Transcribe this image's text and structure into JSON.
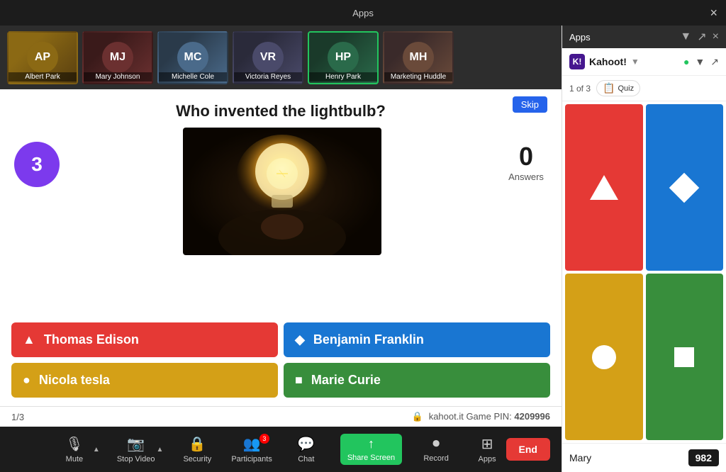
{
  "topbar": {
    "title": "Apps",
    "close_label": "×"
  },
  "video_bar": {
    "participants": [
      {
        "name": "Albert Park",
        "initials": "AP",
        "color": "#8b6914",
        "active": false
      },
      {
        "name": "Mary Johnson",
        "initials": "MJ",
        "color": "#6b3030",
        "active": false
      },
      {
        "name": "Michelle Cole",
        "initials": "MC",
        "color": "#4a6a8a",
        "active": false
      },
      {
        "name": "Victoria Reyes",
        "initials": "VR",
        "color": "#4a4a6a",
        "active": false
      },
      {
        "name": "Henry Park",
        "initials": "HP",
        "color": "#2a6a4a",
        "active": true
      },
      {
        "name": "Marketing Huddle",
        "initials": "MH",
        "color": "#6a4a3a",
        "active": false
      }
    ]
  },
  "question": {
    "text": "Who invented the lightbulb?",
    "timer": "3",
    "answers_count": "0",
    "answers_label": "Answers",
    "skip_label": "Skip"
  },
  "answers": [
    {
      "id": "a",
      "label": "Thomas Edison",
      "color": "red",
      "icon": "▲"
    },
    {
      "id": "b",
      "label": "Benjamin Franklin",
      "color": "blue",
      "icon": "◆"
    },
    {
      "id": "c",
      "label": "Nicola tesla",
      "color": "yellow",
      "icon": "●"
    },
    {
      "id": "d",
      "label": "Marie Curie",
      "color": "green",
      "icon": "■"
    }
  ],
  "footer": {
    "page": "1/3",
    "gamepin_label": "kahoot.it  Game PIN:",
    "gamepin_value": "4209996"
  },
  "zoom_controls": [
    {
      "id": "mute",
      "icon": "🎙",
      "label": "Mute",
      "has_dot": false,
      "has_chevron": true
    },
    {
      "id": "stop-video",
      "icon": "📷",
      "label": "Stop Video",
      "has_dot": false,
      "has_chevron": true
    },
    {
      "id": "security",
      "icon": "🔒",
      "label": "Security",
      "has_dot": false,
      "has_chevron": false
    },
    {
      "id": "participants",
      "icon": "👥",
      "label": "Participants",
      "has_dot": true,
      "has_chevron": false
    },
    {
      "id": "chat",
      "icon": "💬",
      "label": "Chat",
      "has_dot": false,
      "has_chevron": false
    },
    {
      "id": "share-screen",
      "icon": "↑",
      "label": "Share Screen",
      "has_dot": false,
      "has_chevron": false,
      "active": true
    },
    {
      "id": "record",
      "icon": "⏺",
      "label": "Record",
      "has_dot": false,
      "has_chevron": false
    },
    {
      "id": "apps",
      "icon": "⊞",
      "label": "Apps",
      "has_dot": false,
      "has_chevron": false
    }
  ],
  "end_button": {
    "label": "End"
  },
  "sidebar": {
    "title": "Apps",
    "close": "×",
    "kahoot_name": "Kahoot!",
    "question_counter": "1 of 3",
    "quiz_badge": "Quiz",
    "shapes": [
      {
        "color": "red",
        "shape": "triangle"
      },
      {
        "color": "blue",
        "shape": "diamond"
      },
      {
        "color": "yellow",
        "shape": "circle"
      },
      {
        "color": "green",
        "shape": "square"
      }
    ],
    "leader": {
      "name": "Mary",
      "score": "982"
    }
  }
}
